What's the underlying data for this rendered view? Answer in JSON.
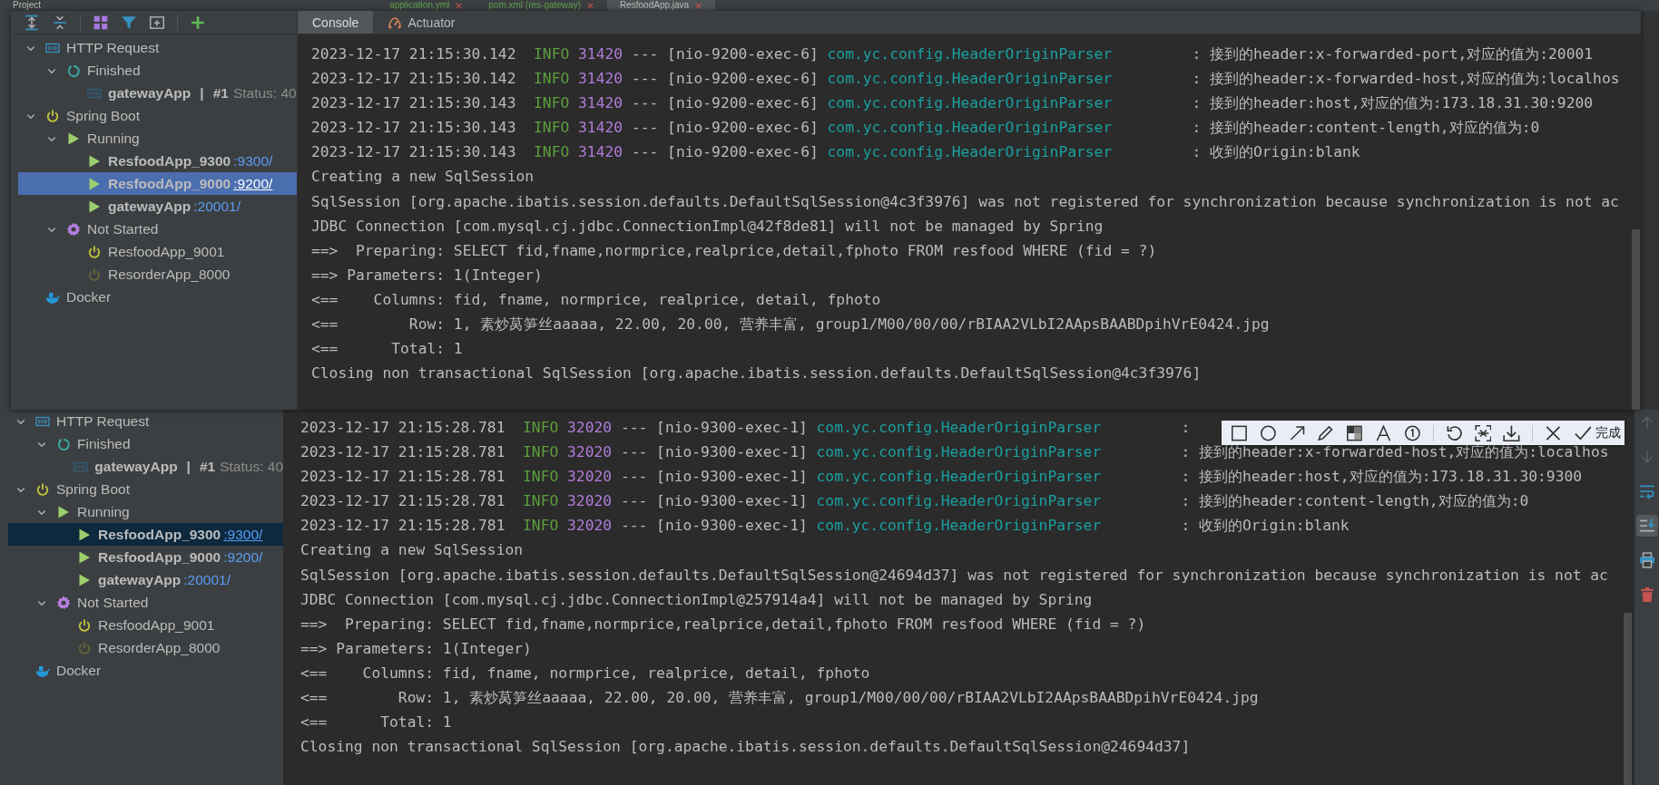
{
  "top_strip": {
    "project_label": "Project",
    "editor_tabs": [
      {
        "label": "application.yml",
        "selected": false
      },
      {
        "label": "pom.xml (res-gateway)",
        "selected": false
      },
      {
        "label": "ResfoodApp.java",
        "selected": true
      }
    ]
  },
  "snapshot": {
    "tree": [
      {
        "kind": "api-group",
        "label": "HTTP Request",
        "expanded": true,
        "selected": false,
        "children": [
          {
            "kind": "finished",
            "label": "Finished",
            "expanded": true,
            "selected": false,
            "children": [
              {
                "kind": "request",
                "label": "gatewayApp",
                "separator": "|",
                "run": "#1",
                "status": "Status: 40",
                "selected": false
              }
            ]
          }
        ]
      },
      {
        "kind": "spring",
        "label": "Spring Boot",
        "expanded": true,
        "selected": false,
        "children": [
          {
            "kind": "running",
            "label": "Running",
            "expanded": true,
            "selected": false,
            "children": [
              {
                "kind": "app",
                "label": "ResfoodApp_9300",
                "port": ":9300/",
                "selected": false
              },
              {
                "kind": "app",
                "label": "ResfoodApp_9000",
                "port": ":9200/",
                "selected": true
              },
              {
                "kind": "app",
                "label": "gatewayApp",
                "port": ":20001/",
                "selected": false
              }
            ]
          },
          {
            "kind": "not-started",
            "label": "Not Started",
            "expanded": true,
            "selected": false,
            "children": [
              {
                "kind": "app-idle",
                "label": "ResfoodApp_9001",
                "selected": false
              },
              {
                "kind": "app-idle-dim",
                "label": "ResorderApp_8000",
                "selected": false
              }
            ]
          }
        ]
      },
      {
        "kind": "docker",
        "label": "Docker",
        "selected": false
      }
    ],
    "console_tabs": [
      {
        "label": "Console",
        "selected": true
      },
      {
        "label": "Actuator",
        "selected": false
      }
    ],
    "console_lines": [
      {
        "kind": "log",
        "timestamp": "2023-12-17 21:15:30.142",
        "level": "INFO",
        "pid": "31420",
        "separator": "---",
        "thread": "[nio-9200-exec-6]",
        "logger": "com.yc.config.HeaderOriginParser",
        "message": ": 接到的header:x-forwarded-port,对应的值为:20001"
      },
      {
        "kind": "log",
        "timestamp": "2023-12-17 21:15:30.142",
        "level": "INFO",
        "pid": "31420",
        "separator": "---",
        "thread": "[nio-9200-exec-6]",
        "logger": "com.yc.config.HeaderOriginParser",
        "message": ": 接到的header:x-forwarded-host,对应的值为:localhos"
      },
      {
        "kind": "log",
        "timestamp": "2023-12-17 21:15:30.143",
        "level": "INFO",
        "pid": "31420",
        "separator": "---",
        "thread": "[nio-9200-exec-6]",
        "logger": "com.yc.config.HeaderOriginParser",
        "message": ": 接到的header:host,对应的值为:173.18.31.30:9200"
      },
      {
        "kind": "log",
        "timestamp": "2023-12-17 21:15:30.143",
        "level": "INFO",
        "pid": "31420",
        "separator": "---",
        "thread": "[nio-9200-exec-6]",
        "logger": "com.yc.config.HeaderOriginParser",
        "message": ": 接到的header:content-length,对应的值为:0"
      },
      {
        "kind": "log",
        "timestamp": "2023-12-17 21:15:30.143",
        "level": "INFO",
        "pid": "31420",
        "separator": "---",
        "thread": "[nio-9200-exec-6]",
        "logger": "com.yc.config.HeaderOriginParser",
        "message": ": 收到的Origin:blank"
      },
      {
        "kind": "plain",
        "text": "Creating a new SqlSession"
      },
      {
        "kind": "plain",
        "text": "SqlSession [org.apache.ibatis.session.defaults.DefaultSqlSession@4c3f3976] was not registered for synchronization because synchronization is not ac"
      },
      {
        "kind": "plain",
        "text": "JDBC Connection [com.mysql.cj.jdbc.ConnectionImpl@42f8de81] will not be managed by Spring"
      },
      {
        "kind": "plain",
        "text": "==>  Preparing: SELECT fid,fname,normprice,realprice,detail,fphoto FROM resfood WHERE (fid = ?)"
      },
      {
        "kind": "plain",
        "text": "==> Parameters: 1(Integer)"
      },
      {
        "kind": "plain",
        "text": "<==    Columns: fid, fname, normprice, realprice, detail, fphoto"
      },
      {
        "kind": "plain",
        "text": "<==        Row: 1, 素炒莴笋丝aaaaa, 22.00, 20.00, 营养丰富, group1/M00/00/00/rBIAA2VLbI2AApsBAABDpihVrE0424.jpg"
      },
      {
        "kind": "plain",
        "text": "<==      Total: 1"
      },
      {
        "kind": "plain",
        "text": "Closing non transactional SqlSession [org.apache.ibatis.session.defaults.DefaultSqlSession@4c3f3976]"
      }
    ]
  },
  "services": {
    "tree": [
      {
        "kind": "api-group",
        "label": "HTTP Request",
        "expanded": true,
        "selected": false,
        "children": [
          {
            "kind": "finished",
            "label": "Finished",
            "expanded": true,
            "selected": false,
            "children": [
              {
                "kind": "request",
                "label": "gatewayApp",
                "separator": "|",
                "run": "#1",
                "status": "Status: 40",
                "selected": false
              }
            ]
          }
        ]
      },
      {
        "kind": "spring",
        "label": "Spring Boot",
        "expanded": true,
        "selected": false,
        "children": [
          {
            "kind": "running",
            "label": "Running",
            "expanded": true,
            "selected": false,
            "children": [
              {
                "kind": "app",
                "label": "ResfoodApp_9300",
                "port": ":9300/",
                "selected": true
              },
              {
                "kind": "app",
                "label": "ResfoodApp_9000",
                "port": ":9200/",
                "selected": false
              },
              {
                "kind": "app",
                "label": "gatewayApp",
                "port": ":20001/",
                "selected": false
              }
            ]
          },
          {
            "kind": "not-started",
            "label": "Not Started",
            "expanded": true,
            "selected": false,
            "children": [
              {
                "kind": "app-idle",
                "label": "ResfoodApp_9001",
                "selected": false
              },
              {
                "kind": "app-idle-dim",
                "label": "ResorderApp_8000",
                "selected": false
              }
            ]
          }
        ]
      },
      {
        "kind": "docker",
        "label": "Docker",
        "selected": false
      }
    ],
    "console_lines": [
      {
        "kind": "log",
        "timestamp": "2023-12-17 21:15:28.781",
        "level": "INFO",
        "pid": "32020",
        "separator": "---",
        "thread": "[nio-9300-exec-1]",
        "logger": "com.yc.config.HeaderOriginParser",
        "message": ":"
      },
      {
        "kind": "log",
        "timestamp": "2023-12-17 21:15:28.781",
        "level": "INFO",
        "pid": "32020",
        "separator": "---",
        "thread": "[nio-9300-exec-1]",
        "logger": "com.yc.config.HeaderOriginParser",
        "message": ": 接到的header:x-forwarded-host,对应的值为:localhos"
      },
      {
        "kind": "log",
        "timestamp": "2023-12-17 21:15:28.781",
        "level": "INFO",
        "pid": "32020",
        "separator": "---",
        "thread": "[nio-9300-exec-1]",
        "logger": "com.yc.config.HeaderOriginParser",
        "message": ": 接到的header:host,对应的值为:173.18.31.30:9300"
      },
      {
        "kind": "log",
        "timestamp": "2023-12-17 21:15:28.781",
        "level": "INFO",
        "pid": "32020",
        "separator": "---",
        "thread": "[nio-9300-exec-1]",
        "logger": "com.yc.config.HeaderOriginParser",
        "message": ": 接到的header:content-length,对应的值为:0"
      },
      {
        "kind": "log",
        "timestamp": "2023-12-17 21:15:28.781",
        "level": "INFO",
        "pid": "32020",
        "separator": "---",
        "thread": "[nio-9300-exec-1]",
        "logger": "com.yc.config.HeaderOriginParser",
        "message": ": 收到的Origin:blank"
      },
      {
        "kind": "plain",
        "text": "Creating a new SqlSession"
      },
      {
        "kind": "plain",
        "text": "SqlSession [org.apache.ibatis.session.defaults.DefaultSqlSession@24694d37] was not registered for synchronization because synchronization is not ac"
      },
      {
        "kind": "plain",
        "text": "JDBC Connection [com.mysql.cj.jdbc.ConnectionImpl@257914a4] will not be managed by Spring"
      },
      {
        "kind": "plain",
        "text": "==>  Preparing: SELECT fid,fname,normprice,realprice,detail,fphoto FROM resfood WHERE (fid = ?)"
      },
      {
        "kind": "plain",
        "text": "==> Parameters: 1(Integer)"
      },
      {
        "kind": "plain",
        "text": "<==    Columns: fid, fname, normprice, realprice, detail, fphoto"
      },
      {
        "kind": "plain",
        "text": "<==        Row: 1, 素炒莴笋丝aaaaa, 22.00, 20.00, 营养丰富, group1/M00/00/00/rBIAA2VLbI2AApsBAABDpihVrE0424.jpg"
      },
      {
        "kind": "plain",
        "text": "<==      Total: 1"
      },
      {
        "kind": "plain",
        "text": "Closing non transactional SqlSession [org.apache.ibatis.session.defaults.DefaultSqlSession@24694d37]"
      }
    ]
  },
  "capture_toolbar": {
    "done_label": "完成"
  }
}
